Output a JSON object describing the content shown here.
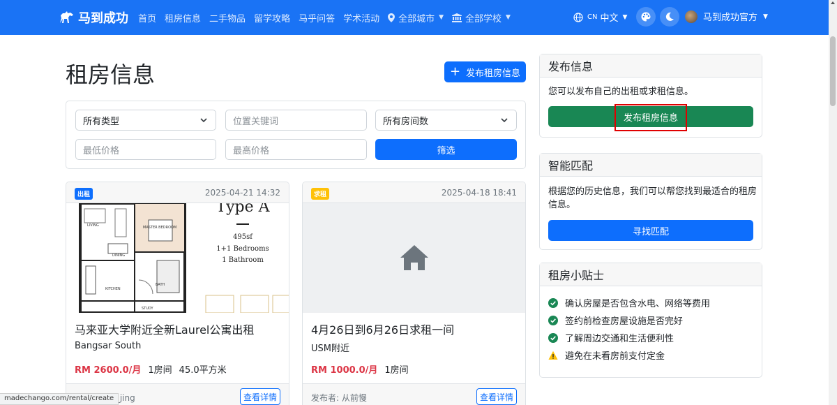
{
  "nav": {
    "brand": "马到成功",
    "links": [
      "首页",
      "租房信息",
      "二手物品",
      "留学攻略",
      "马乎问答",
      "学术活动"
    ],
    "city": "全部城市",
    "school": "全部学校",
    "lang_code": "CN",
    "lang": "中文",
    "user": "马到成功官方"
  },
  "page": {
    "title": "租房信息",
    "publish_button": "发布租房信息"
  },
  "filters": {
    "type": "所有类型",
    "location_placeholder": "位置关键词",
    "rooms": "所有房间数",
    "min_price_placeholder": "最低价格",
    "max_price_placeholder": "最高价格",
    "filter_button": "筛选"
  },
  "listings": [
    {
      "badge": "出租",
      "badge_color": "#0d6efd",
      "date": "2025-04-21 14:32",
      "title": "马来亚大学附近全新Laurel公寓出租",
      "location": "Bangsar South",
      "price": "RM 2600.0/月",
      "rooms": "1房间",
      "area": "45.0平方米",
      "poster": "发布者: ah_jing",
      "detail": "查看详情",
      "floorplan": {
        "type": "Type A",
        "size": "495sf",
        "bedrooms": "1+1 Bedrooms",
        "bathrooms": "1 Bathroom",
        "rooms": [
          "LIVING",
          "MASTER BEDROOM",
          "DINING",
          "KITCHEN",
          "BATH",
          "STUDY"
        ]
      }
    },
    {
      "badge": "求租",
      "badge_color": "#ffc107",
      "date": "2025-04-18 18:41",
      "title": "4月26日到6月26日求租一间",
      "location": "USM附近",
      "price": "RM 1000.0/月",
      "rooms": "1房间",
      "poster": "发布者: 从前慢",
      "detail": "查看详情"
    }
  ],
  "sidebar": {
    "publish": {
      "title": "发布信息",
      "text": "您可以发布自己的出租或求租信息。",
      "button": "发布租房信息"
    },
    "match": {
      "title": "智能匹配",
      "text_line1": "根据您的历史信息，我们可以帮您找到最适合的租房",
      "text_line2": "信息。",
      "button": "寻找匹配"
    },
    "tips": {
      "title": "租房小贴士",
      "items": [
        {
          "text": "确认房屋是否包含水电、网络等费用",
          "icon": "check-circle-icon"
        },
        {
          "text": "签约前检查房屋设施是否完好",
          "icon": "check-circle-icon"
        },
        {
          "text": "了解周边交通和生活便利性",
          "icon": "check-circle-icon"
        },
        {
          "text": "避免在未看房前支付定金",
          "icon": "warning-triangle-icon"
        }
      ]
    }
  },
  "statusbar": "madechango.com/rental/create",
  "colors": {
    "navbar": "#1a73f5",
    "primary": "#0d6efd",
    "success": "#198754",
    "danger": "#dc3545",
    "warning": "#ffc107",
    "highlight": "#e00000"
  }
}
